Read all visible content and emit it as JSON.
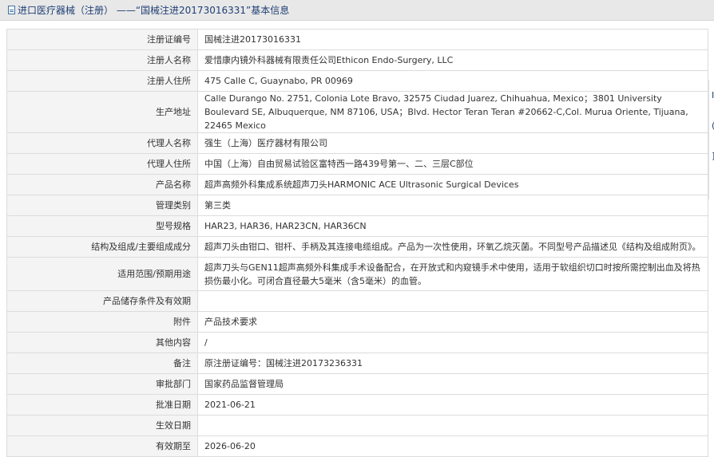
{
  "header": {
    "title": "进口医疗器械（注册） ——“国械注进20173016331”基本信息"
  },
  "rows": [
    {
      "label": "注册证编号",
      "value": "国械注进20173016331"
    },
    {
      "label": "注册人名称",
      "value": "爱惜康内镜外科器械有限责任公司Ethicon Endo-Surgery, LLC"
    },
    {
      "label": "注册人住所",
      "value": "475 Calle C, Guaynabo, PR 00969"
    },
    {
      "label": "生产地址",
      "value": "Calle Durango No. 2751, Colonia Lote Bravo, 32575 Ciudad Juarez, Chihuahua, Mexico；3801 University Boulevard SE, Albuquerque, NM 87106, USA；Blvd. Hector Teran Teran #20662-C,Col. Murua Oriente, Tijuana, 22465 Mexico"
    },
    {
      "label": "代理人名称",
      "value": "强生（上海）医疗器材有限公司"
    },
    {
      "label": "代理人住所",
      "value": "中国（上海）自由贸易试验区富特西一路439号第一、二、三层C部位"
    },
    {
      "label": "产品名称",
      "value": "超声高频外科集成系统超声刀头HARMONIC ACE Ultrasonic Surgical Devices"
    },
    {
      "label": "管理类别",
      "value": "第三类"
    },
    {
      "label": "型号规格",
      "value": "HAR23, HAR36, HAR23CN, HAR36CN"
    },
    {
      "label": "结构及组成/主要组成成分",
      "value": "超声刀头由钳口、钳杆、手柄及其连接电缆组成。产品为一次性使用，环氧乙烷灭菌。不同型号产品描述见《结构及组成附页》。"
    },
    {
      "label": "适用范围/预期用途",
      "value": "超声刀头与GEN11超声高频外科集成手术设备配合，在开放式和内窥镜手术中使用，适用于软组织切口时按所需控制出血及将热损伤最小化。可闭合直径最大5毫米（含5毫米）的血管。"
    },
    {
      "label": "产品储存条件及有效期",
      "value": ""
    },
    {
      "label": "附件",
      "value": "产品技术要求"
    },
    {
      "label": "其他内容",
      "value": "/"
    },
    {
      "label": "备注",
      "value": "原注册证编号：国械注进20173236331"
    },
    {
      "label": "审批部门",
      "value": "国家药品监督管理局"
    },
    {
      "label": "批准日期",
      "value": "2021-06-21"
    },
    {
      "label": "生效日期",
      "value": ""
    },
    {
      "label": "有效期至",
      "value": "2026-06-20"
    }
  ],
  "side_strip": {
    "marks": [
      "I",
      "(",
      "]"
    ]
  }
}
